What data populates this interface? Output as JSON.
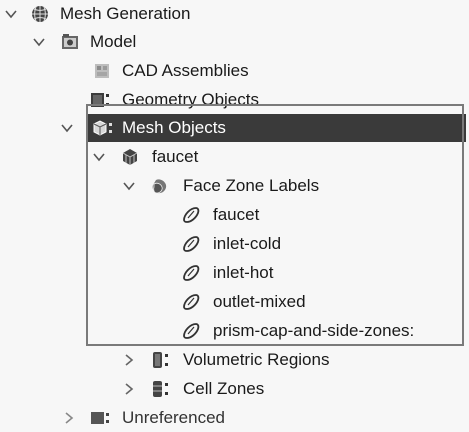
{
  "tree": {
    "mesh_generation": "Mesh Generation",
    "model": "Model",
    "cad_assemblies": "CAD Assemblies",
    "geometry_objects": "Geometry Objects",
    "mesh_objects": "Mesh Objects",
    "faucet": "faucet",
    "face_zone_labels": "Face Zone Labels",
    "zones": [
      "faucet",
      "inlet-cold",
      "inlet-hot",
      "outlet-mixed",
      "prism-cap-and-side-zones:"
    ],
    "volumetric_regions": "Volumetric Regions",
    "cell_zones": "Cell Zones",
    "unreferenced": "Unreferenced"
  },
  "colors": {
    "selection": "#3a3a3a",
    "highlight_frame": "#7a7a7a"
  }
}
